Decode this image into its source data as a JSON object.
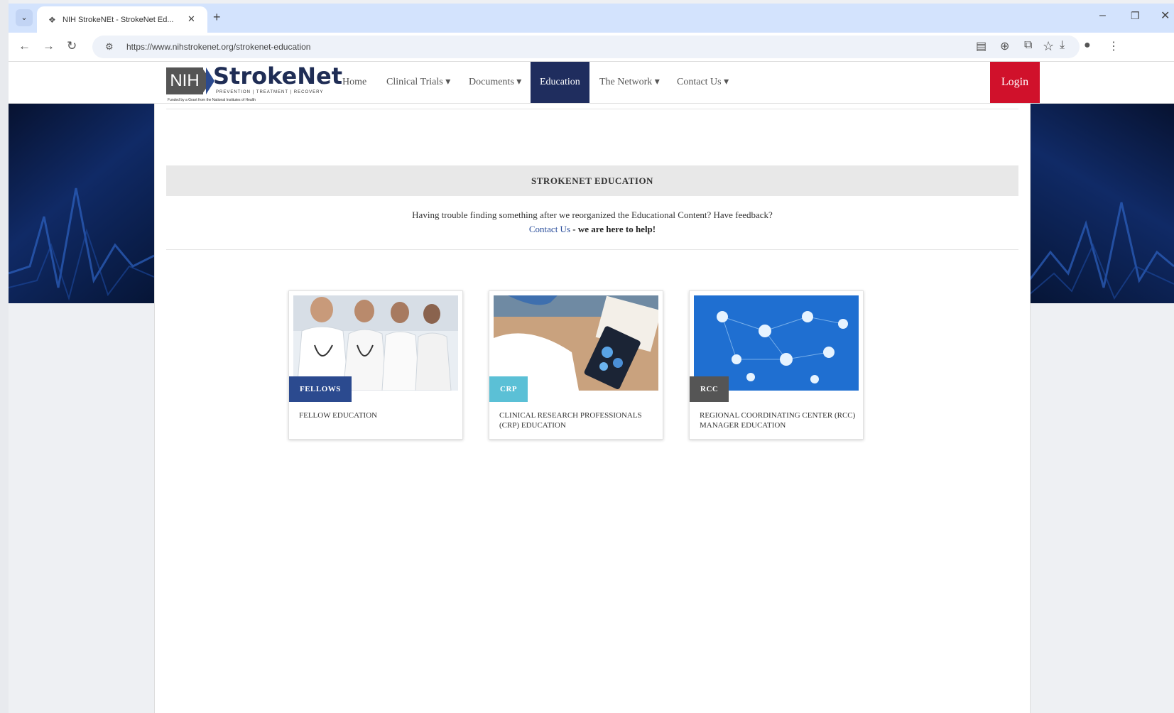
{
  "browser": {
    "tab_title": "NIH StrokeNEt - StrokeNet Ed...",
    "url": "https://www.nihstrokenet.org/strokenet-education"
  },
  "site": {
    "logo_nih": "NIH",
    "logo_name": "StrokeNet",
    "logo_tagline": "PREVENTION | TREATMENT | RECOVERY",
    "logo_funding": "Funded by a Grant from the National Institutes of Health",
    "nav": {
      "home": "Home",
      "clinical_trials": "Clinical Trials",
      "documents": "Documents",
      "education": "Education",
      "network": "The Network",
      "contact": "Contact Us"
    },
    "login": "Login"
  },
  "main": {
    "section_title": "STROKENET EDUCATION",
    "help_text": "Having trouble finding something after we reorganized the Educational Content?  Have feedback?",
    "help_link": "Contact Us",
    "help_suffix": " - we are here to help!"
  },
  "cards": [
    {
      "badge": "FELLOWS",
      "title": "FELLOW EDUCATION",
      "badge_color": "#2b4a8f"
    },
    {
      "badge": "CRP",
      "title": "CLINICAL RESEARCH PROFESSIONALS (CRP) EDUCATION",
      "badge_color": "#5bc0d6"
    },
    {
      "badge": "RCC",
      "title": "REGIONAL COORDINATING CENTER (RCC) MANAGER EDUCATION",
      "badge_color": "#555555"
    }
  ],
  "colors": {
    "nav_active_bg": "#1f2d5e",
    "login_bg": "#d0112b",
    "tabstrip_bg": "#d3e3fd"
  }
}
